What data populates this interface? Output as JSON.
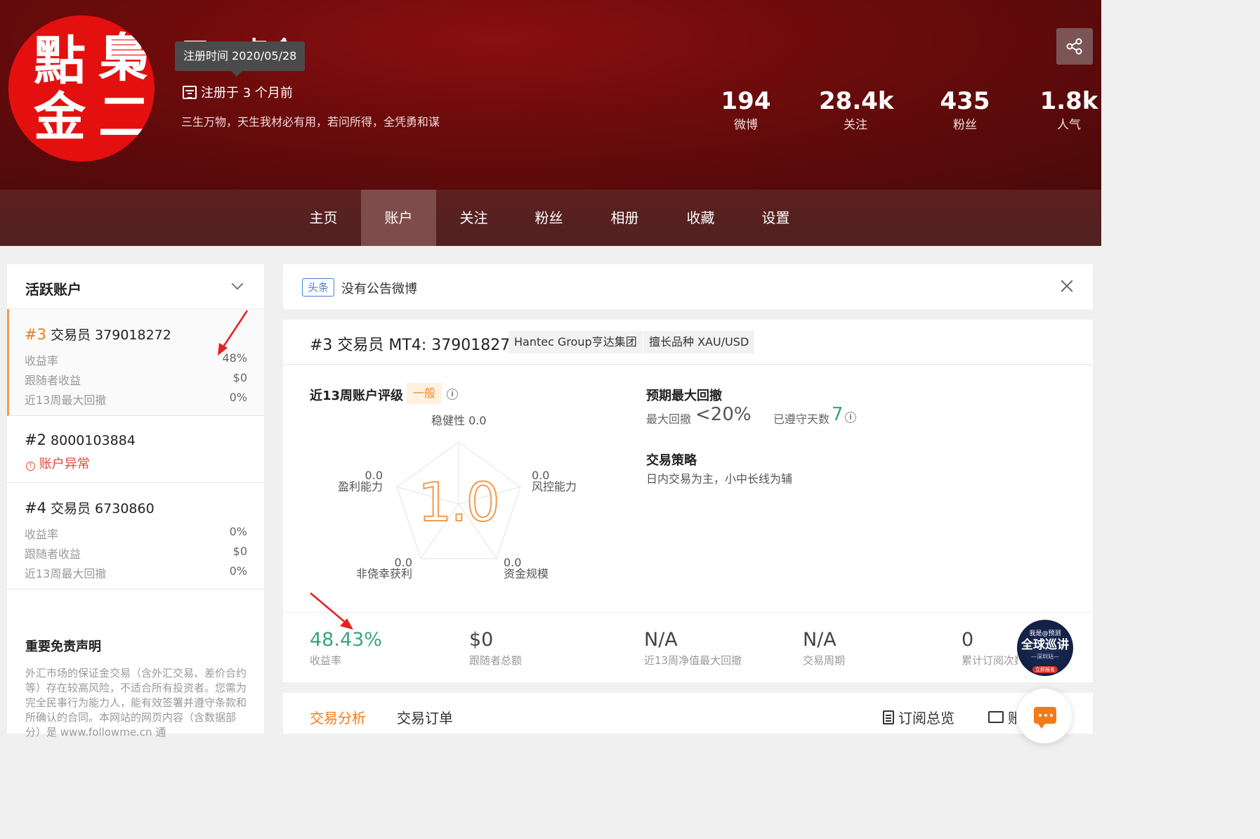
{
  "header": {
    "avatar_chars": [
      "點",
      "梟",
      "金",
      "二"
    ],
    "user_name": "五二点金",
    "tooltip": "注册时间 2020/05/28",
    "registered": "注册于 3 个月前",
    "bio": "三生万物，天生我材必有用，若问所得，全凭勇和谋",
    "stats": [
      {
        "num": "194",
        "label": "微博"
      },
      {
        "num": "28.4k",
        "label": "关注"
      },
      {
        "num": "435",
        "label": "粉丝"
      },
      {
        "num": "1.8k",
        "label": "人气"
      }
    ]
  },
  "nav": {
    "items": [
      "主页",
      "账户",
      "关注",
      "粉丝",
      "相册",
      "收藏",
      "设置"
    ],
    "active": "账户"
  },
  "sidebar": {
    "title": "活跃账户",
    "accounts": [
      {
        "rank": "#3",
        "name": "交易员 379018272",
        "rows": [
          {
            "k": "收益率",
            "v": "48%"
          },
          {
            "k": "跟随者收益",
            "v": "$0"
          },
          {
            "k": "近13周最大回撤",
            "v": "0%"
          }
        ]
      },
      {
        "rank": "#2",
        "name": "8000103884",
        "error": "账户异常"
      },
      {
        "rank": "#4",
        "name": "交易员 6730860",
        "rows": [
          {
            "k": "收益率",
            "v": "0%"
          },
          {
            "k": "跟随者收益",
            "v": "$0"
          },
          {
            "k": "近13周最大回撤",
            "v": "0%"
          }
        ]
      }
    ],
    "disclaimer_title": "重要免责声明",
    "disclaimer": "外汇市场的保证金交易（含外汇交易、差价合约等）存在较高风险，不适合所有投资者。您需为完全民事行为能力人，能有效签署并遵守条款和所确认的合同。本网站的网页内容（含数据部分）是 www.followme.cn 通"
  },
  "notice": {
    "tag": "头条",
    "text": "没有公告微博"
  },
  "card": {
    "title": "#3 交易员 MT4: 379018272",
    "chips": [
      "Hantec Group亨达集团",
      "擅长品种 XAU/USD"
    ],
    "rating_title": "近13周账户评级",
    "rating_badge": "一般",
    "score": "1.0",
    "radar": [
      {
        "label": "稳健性",
        "value": "0.0"
      },
      {
        "label": "风控能力",
        "value": "0.0"
      },
      {
        "label": "资金规模",
        "value": "0.0"
      },
      {
        "label": "非侥幸获利",
        "value": "0.0"
      },
      {
        "label": "盈利能力",
        "value": "0.0"
      }
    ],
    "drawdown_title": "预期最大回撤",
    "drawdown_label": "最大回撤",
    "drawdown_value": "<20%",
    "days_label": "已遵守天数",
    "days_value": "7",
    "strategy_title": "交易策略",
    "strategy": "日内交易为主，小中长线为辅",
    "kpis": [
      {
        "value": "48.43%",
        "label": "收益率"
      },
      {
        "value": "$0",
        "label": "跟随者总额"
      },
      {
        "value": "N/A",
        "label": "近13周净值最大回撤"
      },
      {
        "value": "N/A",
        "label": "交易周期"
      },
      {
        "value": "0",
        "label": "累计订阅次数"
      }
    ]
  },
  "tabs": {
    "items": [
      "交易分析",
      "交易订单"
    ],
    "tools": [
      "订阅总览",
      "账户"
    ]
  },
  "promo": {
    "line1": "我是@预测",
    "line2": "全球巡讲",
    "line3": "—深圳站—",
    "line4": "立即报名"
  },
  "colors": {
    "accent_orange": "#f07b1b",
    "green": "#3aa57a",
    "banner_red": "#6d0b0c",
    "error_red": "#e2463a",
    "arrow_red": "#e82020"
  }
}
